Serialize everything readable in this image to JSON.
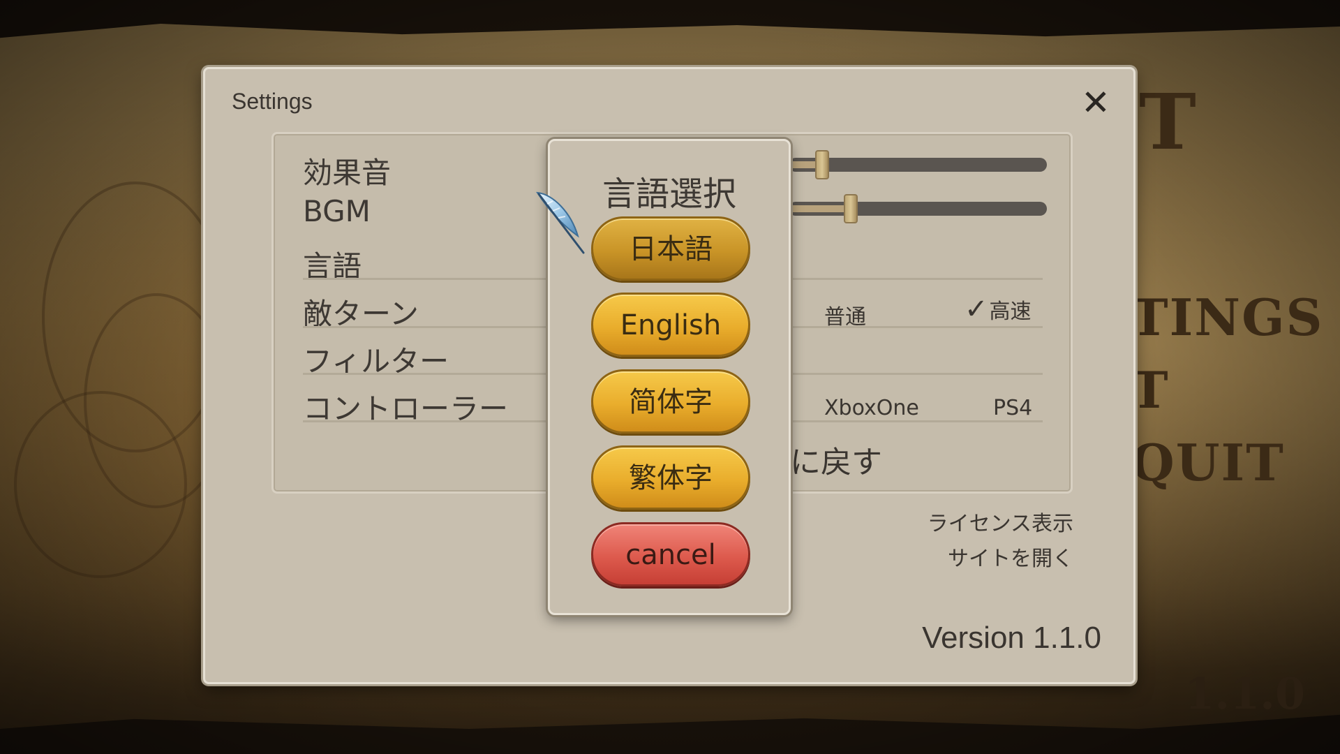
{
  "background": {
    "menu_items": [
      "T",
      "TINGS",
      "T",
      "QUIT"
    ],
    "version": "1.1.0"
  },
  "settings": {
    "title": "Settings",
    "close_icon": "close-icon",
    "rows": {
      "sfx": {
        "label": "効果音",
        "level": 0.13
      },
      "bgm": {
        "label": "BGM",
        "level": 0.24
      },
      "language": {
        "label": "言語"
      },
      "enemy_turn": {
        "label": "敵ターン",
        "options": [
          "普通",
          "高速"
        ],
        "selected": "高速"
      },
      "filter": {
        "label": "フィルター"
      },
      "controller": {
        "label": "コントローラー",
        "options": [
          "XboxOne",
          "PS4"
        ]
      }
    },
    "reset_fragment": "に戻す",
    "license_link": "ライセンス表示",
    "site_link": "サイトを開く",
    "version": "Version 1.1.0"
  },
  "language_popup": {
    "title": "言語選択",
    "buttons": {
      "japanese": "日本語",
      "english": "English",
      "simplified": "简体字",
      "traditional": "繁体字",
      "cancel": "cancel"
    }
  },
  "colors": {
    "dialog_bg": "#c8bfaf",
    "gold_button": "#e9ad2c",
    "cancel_button": "#dd5a4d",
    "slider_track": "#5a5550"
  }
}
